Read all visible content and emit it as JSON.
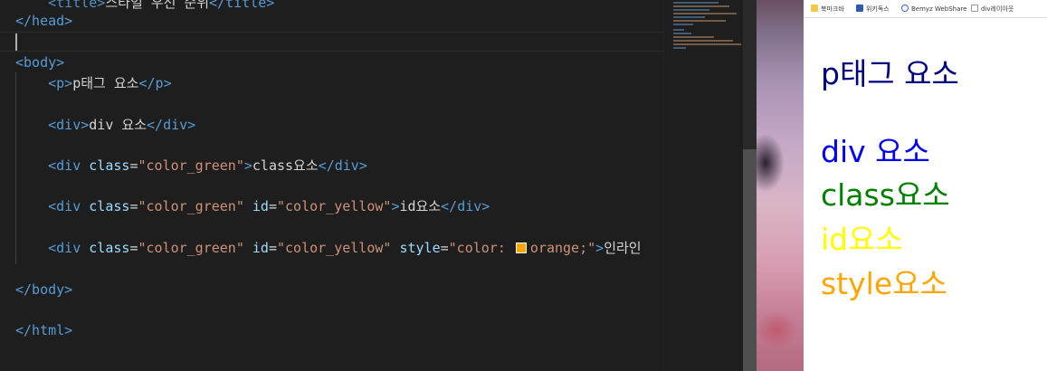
{
  "editor": {
    "lines": {
      "head_close": "</head>",
      "body_open": "<body>",
      "p_text": "p태그 요소",
      "div_text": "div 요소",
      "class_text": "class요소",
      "id_text": "id요소",
      "inline_text": "인라인",
      "body_close": "</body>",
      "html_close": "</html>"
    },
    "attrs": {
      "class_attr": "class",
      "class_value": "\"color_green\"",
      "id_attr": "id",
      "id_value": "\"color_yellow\"",
      "style_attr": "style",
      "style_value_prefix": "\"color: ",
      "style_value_suffix": "orange;\""
    },
    "colors": {
      "background": "#1e1e1e",
      "tag": "#569cd6",
      "attribute": "#9cdcfe",
      "string": "#ce9178",
      "swatch": "#ffa500"
    }
  },
  "bookmarks": [
    {
      "label": "북마크바",
      "icon": "folder-icon"
    },
    {
      "label": "위키독스",
      "icon": "wikidocs-icon"
    },
    {
      "label": "Bemyz WebShare",
      "icon": "webshare-icon"
    },
    {
      "label": "div레이아웃",
      "icon": "page-icon"
    }
  ],
  "browser_output": [
    {
      "text": "p태그 요소",
      "color": "#000080"
    },
    {
      "text": "div 요소",
      "color": "#0000ff"
    },
    {
      "text": "class요소",
      "color": "#008000"
    },
    {
      "text": "id요소",
      "color": "#ffff00"
    },
    {
      "text": "style요소",
      "color": "#ffa500"
    }
  ]
}
